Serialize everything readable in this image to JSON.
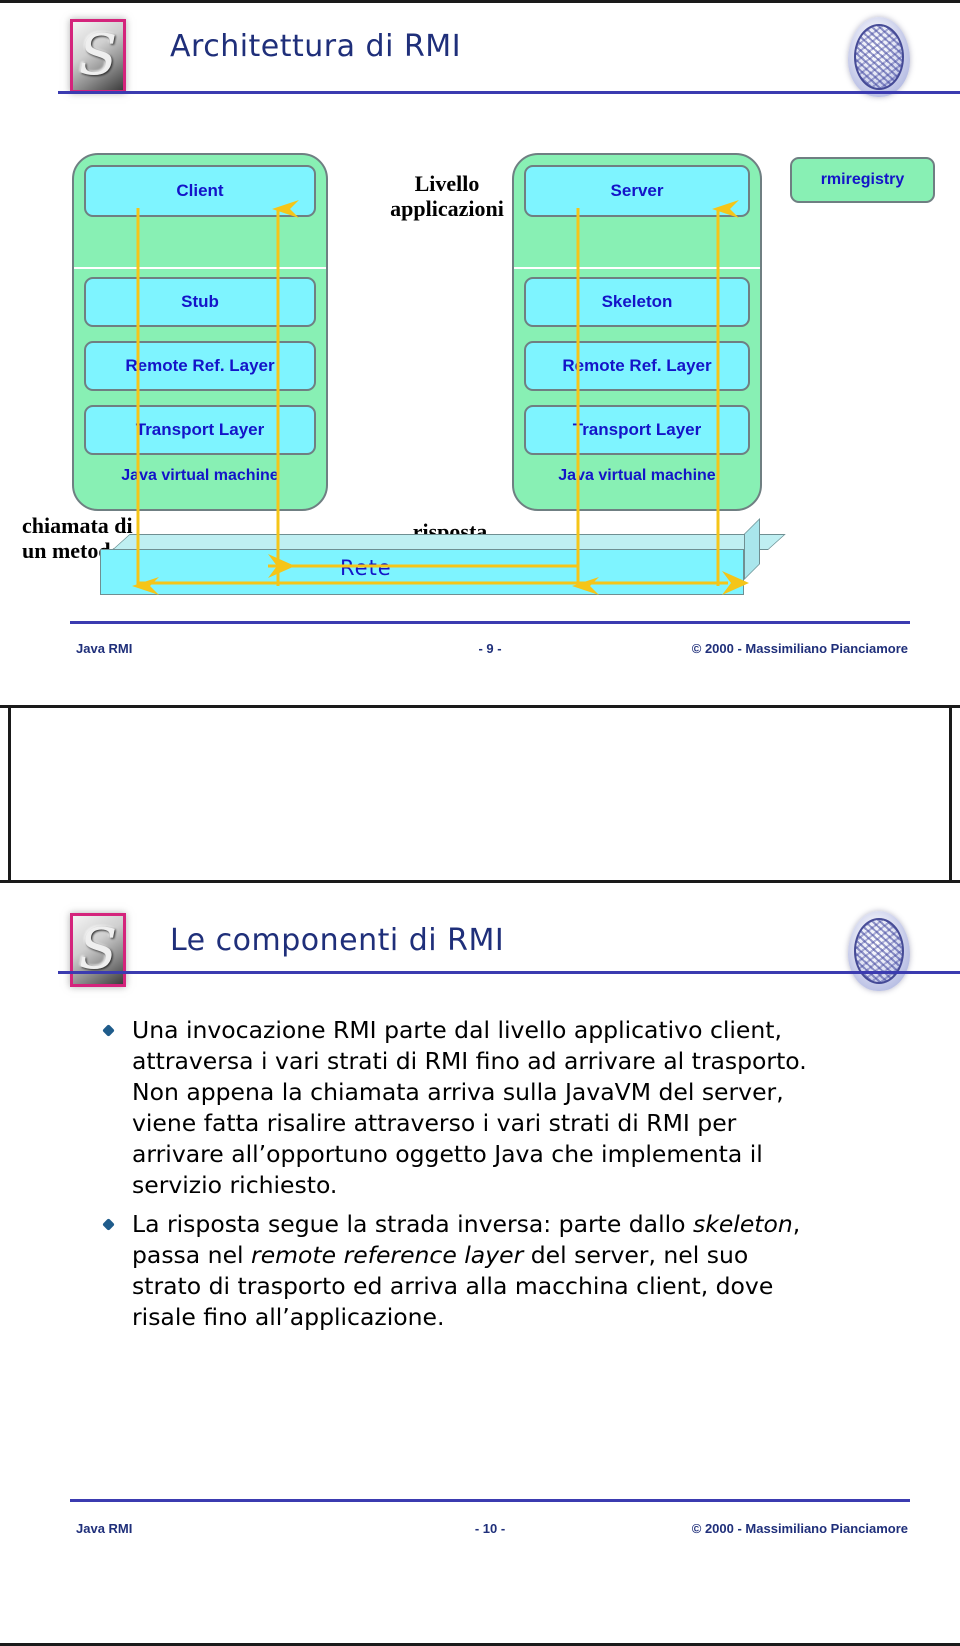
{
  "page": {
    "accent_rule": "#3b3bb0",
    "box_fill": "#7ef4ff",
    "vm_fill": "#88f0b4",
    "box_border": "#6f7f82",
    "label_blue": "#1414c8",
    "arrow_color": "#f5c518"
  },
  "slide1": {
    "title": "Architettura di RMI",
    "logo_left_name": "politecnico-swirl-logo",
    "logo_right_name": "university-seal-logo",
    "diagram": {
      "client_vm": {
        "app_label": "Client",
        "stub_label": "Stub",
        "rrl_label": "Remote Ref. Layer",
        "transport_label": "Transport Layer",
        "caption": "Java virtual machine"
      },
      "server_vm": {
        "app_label": "Server",
        "stub_label": "Skeleton",
        "rrl_label": "Remote Ref. Layer",
        "transport_label": "Transport Layer",
        "caption": "Java virtual machine"
      },
      "registry_label": "rmiregistry",
      "application_level_label": "Livello applicazioni",
      "response_label": "risposta",
      "call_label": "chiamata di un metodo",
      "network_label": "Rete"
    },
    "footer": {
      "left": "Java RMI",
      "page": "- 9 -",
      "right": "© 2000 - Massimiliano Pianciamore"
    }
  },
  "slide2": {
    "title": "Le componenti di RMI",
    "logo_left_name": "politecnico-swirl-logo",
    "logo_right_name": "university-seal-logo",
    "bullets": [
      {
        "id": "bullet-invocazione",
        "parts": [
          {
            "text": "Una invocazione RMI parte dal livello applicativo client, attraversa i vari strati di RMI fino ad arrivare al trasporto. Non appena la chiamata arriva sulla JavaVM del server, viene fatta risalire attraverso i vari strati di RMI per arrivare all’opportuno oggetto Java che implementa il servizio richiesto.",
            "italic": false
          }
        ]
      },
      {
        "id": "bullet-risposta",
        "parts": [
          {
            "text": "La risposta segue la strada inversa: parte dallo ",
            "italic": false
          },
          {
            "text": "skeleton",
            "italic": true
          },
          {
            "text": ", passa nel ",
            "italic": false
          },
          {
            "text": "remote reference layer",
            "italic": true
          },
          {
            "text": " del server, nel suo strato di trasporto ed arriva alla macchina client, dove risale fino all’applicazione.",
            "italic": false
          }
        ]
      }
    ],
    "footer": {
      "left": "Java RMI",
      "page": "- 10 -",
      "right": "© 2000 - Massimiliano Pianciamore"
    }
  }
}
